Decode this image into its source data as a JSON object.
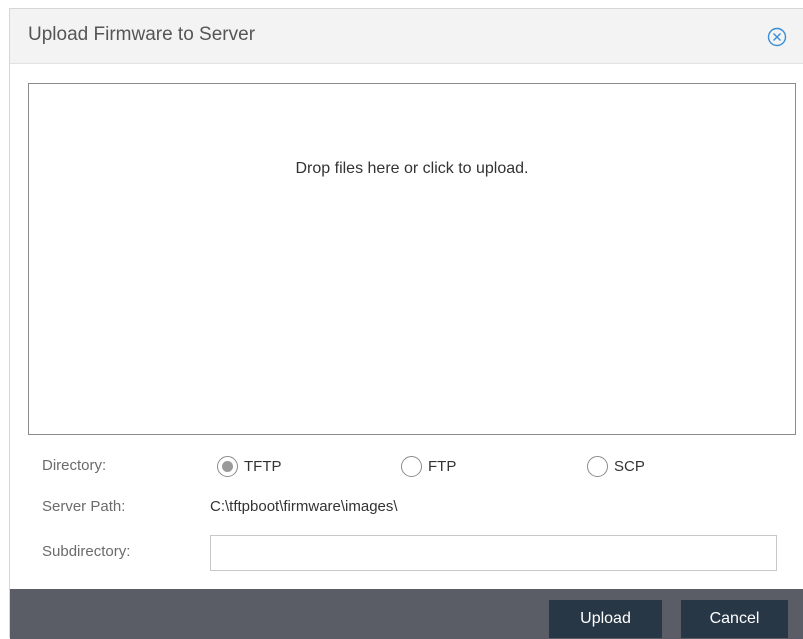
{
  "dialog": {
    "title": "Upload Firmware to Server"
  },
  "dropzone": {
    "message": "Drop files here or click to upload."
  },
  "form": {
    "directory_label": "Directory:",
    "directory_options": [
      {
        "label": "TFTP",
        "checked": true
      },
      {
        "label": "FTP",
        "checked": false
      },
      {
        "label": "SCP",
        "checked": false
      }
    ],
    "server_path_label": "Server Path:",
    "server_path_value": "C:\\tftpboot\\firmware\\images\\",
    "subdirectory_label": "Subdirectory:",
    "subdirectory_value": ""
  },
  "footer": {
    "upload_label": "Upload",
    "cancel_label": "Cancel"
  },
  "icons": {
    "close": "close-circle-icon"
  },
  "colors": {
    "accent": "#3a8fd8",
    "footer_bg": "#5a5d66",
    "button_bg": "#283746"
  }
}
